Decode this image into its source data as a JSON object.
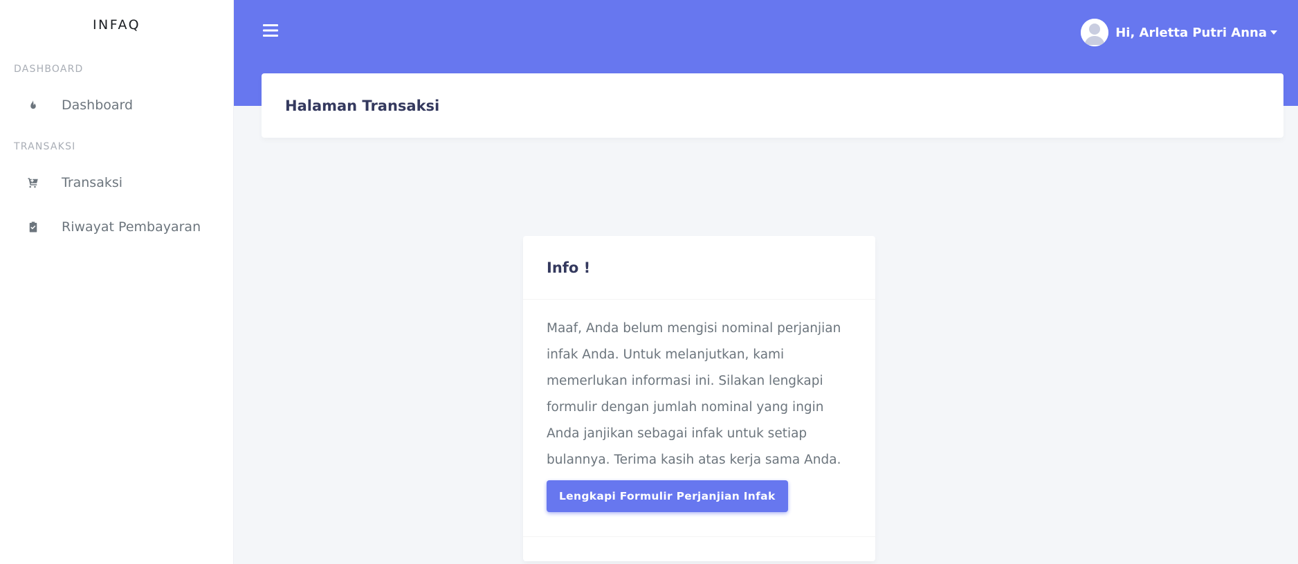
{
  "sidebar": {
    "brand": "INFAQ",
    "sections": [
      {
        "header": "DASHBOARD",
        "items": [
          {
            "label": "Dashboard",
            "icon": "fire-icon"
          }
        ]
      },
      {
        "header": "TRANSAKSI",
        "items": [
          {
            "label": "Transaksi",
            "icon": "cart-icon"
          },
          {
            "label": "Riwayat Pembayaran",
            "icon": "clipboard-check-icon"
          }
        ]
      }
    ]
  },
  "navbar": {
    "menu_icon": "hamburger-icon",
    "user_greeting": "Hi, Arletta Putri Anna",
    "avatar_icon": "user-avatar-icon",
    "background_color": "#6777ef"
  },
  "section_header": {
    "title": "Halaman Transaksi"
  },
  "info_card": {
    "title": "Info !",
    "message": "Maaf, Anda belum mengisi nominal perjanjian infak Anda. Untuk melanjutkan, kami memerlukan informasi ini. Silakan lengkapi formulir dengan jumlah nominal yang ingin Anda janjikan sebagai infak untuk setiap bulannya. Terima kasih atas kerja sama Anda.",
    "button_label": "Lengkapi Formulir Perjanjian Infak",
    "button_color": "#6777ef"
  }
}
